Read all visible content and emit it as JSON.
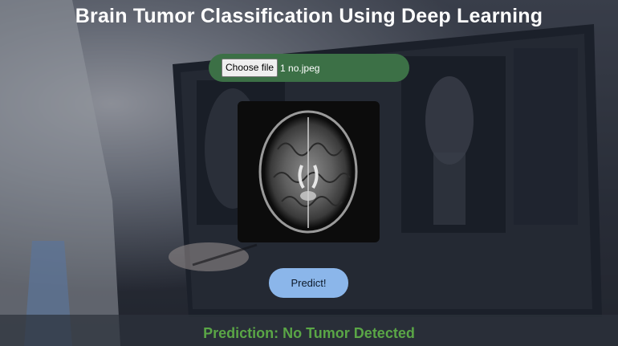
{
  "page": {
    "title": "Brain Tumor Classification Using Deep Learning"
  },
  "upload": {
    "button_label": "Choose file",
    "file_name": "1 no.jpeg"
  },
  "preview": {
    "alt": "MRI scan preview"
  },
  "actions": {
    "predict_label": "Predict!"
  },
  "result": {
    "text": "Prediction: No Tumor Detected",
    "color": "#5aa646"
  },
  "colors": {
    "upload_bar": "#3c7046",
    "predict_button": "#8bb6ea"
  }
}
